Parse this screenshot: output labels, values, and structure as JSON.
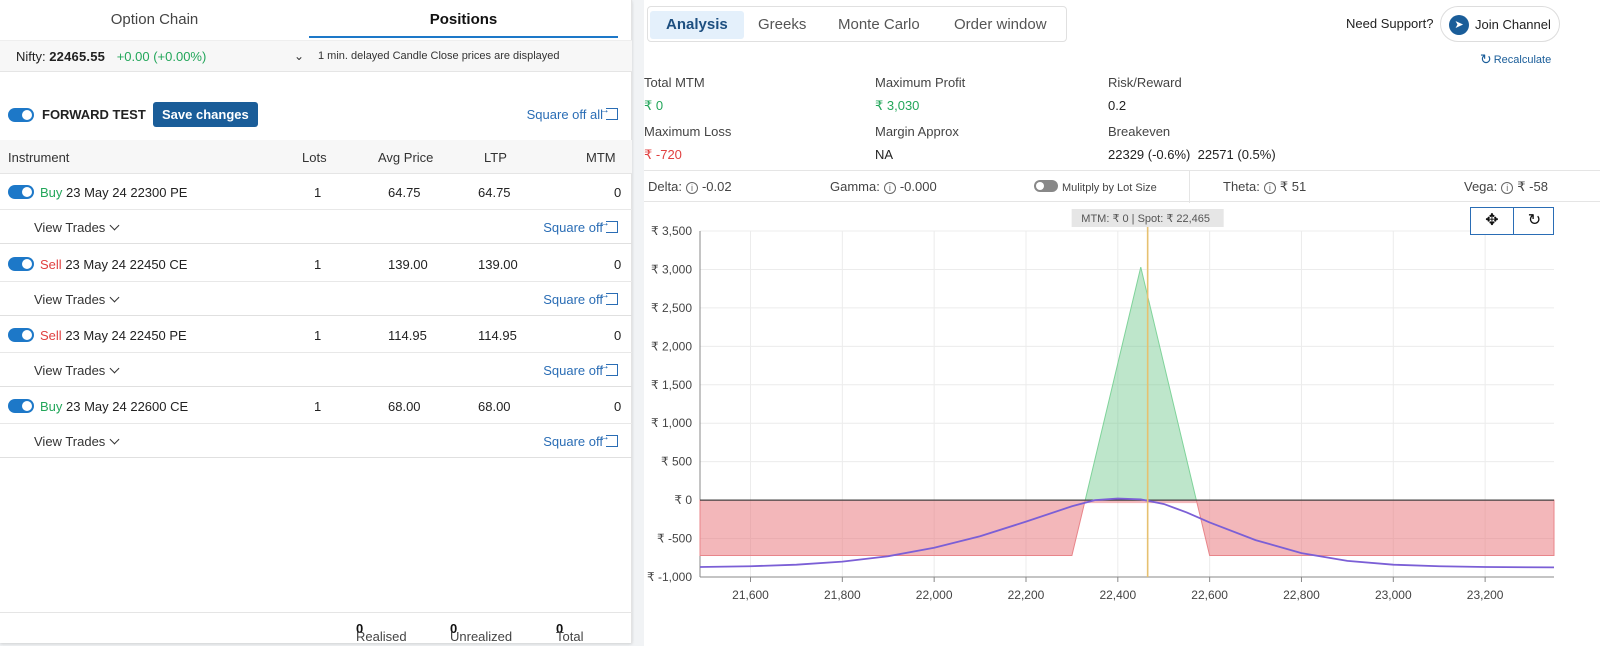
{
  "left": {
    "tabs": [
      {
        "label": "Option Chain"
      },
      {
        "label": "Positions"
      }
    ],
    "nifty": {
      "label": "Nifty:",
      "value": "22465.55",
      "change": "+0.00 (+0.00%)"
    },
    "delay_note": "1 min. delayed Candle Close prices are displayed",
    "forward_test": {
      "label": "FORWARD TEST",
      "save": "Save changes",
      "square_all": "Square off all"
    },
    "columns": {
      "instrument": "Instrument",
      "lots": "Lots",
      "avg": "Avg Price",
      "ltp": "LTP",
      "mtm": "MTM"
    },
    "positions": [
      {
        "side": "Buy",
        "name": "23 May 24 22300 PE",
        "lots": "1",
        "avg": "64.75",
        "ltp": "64.75",
        "mtm": "0",
        "view": "View Trades",
        "square": "Square off"
      },
      {
        "side": "Sell",
        "name": "23 May 24 22450 CE",
        "lots": "1",
        "avg": "139.00",
        "ltp": "139.00",
        "mtm": "0",
        "view": "View Trades",
        "square": "Square off"
      },
      {
        "side": "Sell",
        "name": "23 May 24 22450 PE",
        "lots": "1",
        "avg": "114.95",
        "ltp": "114.95",
        "mtm": "0",
        "view": "View Trades",
        "square": "Square off"
      },
      {
        "side": "Buy",
        "name": "23 May 24 22600 CE",
        "lots": "1",
        "avg": "68.00",
        "ltp": "68.00",
        "mtm": "0",
        "view": "View Trades",
        "square": "Square off"
      }
    ],
    "footer": {
      "realised_label": "Realised",
      "realised": "0",
      "unrealized_label": "Unrealized",
      "unrealized": "0",
      "total_label": "Total",
      "total": "0"
    }
  },
  "right": {
    "tabs": [
      {
        "label": "Analysis"
      },
      {
        "label": "Greeks"
      },
      {
        "label": "Monte Carlo"
      },
      {
        "label": "Order window"
      }
    ],
    "support": "Need Support?",
    "join": "Join Channel",
    "recalculate": "Recalculate",
    "stats": {
      "total_mtm": {
        "label": "Total MTM",
        "value": "₹ 0"
      },
      "max_profit": {
        "label": "Maximum Profit",
        "value": "₹ 3,030"
      },
      "risk_reward": {
        "label": "Risk/Reward",
        "value": "0.2"
      },
      "max_loss": {
        "label": "Maximum Loss",
        "value": "₹ -720"
      },
      "margin": {
        "label": "Margin Approx",
        "value": "NA"
      },
      "breakeven": {
        "label": "Breakeven",
        "value": "22329 (-0.6%)  22571 (0.5%)"
      }
    },
    "greeks": {
      "delta": {
        "label": "Delta:",
        "value": "-0.02"
      },
      "gamma": {
        "label": "Gamma:",
        "value": "-0.000"
      },
      "multiply": "Mulitply by Lot Size",
      "theta": {
        "label": "Theta:",
        "value": "₹ 51"
      },
      "vega": {
        "label": "Vega:",
        "value": "₹ -58"
      }
    },
    "icons": {
      "pan": "move-icon",
      "reset": "reset-icon",
      "telegram": "telegram-icon",
      "refresh": "refresh-icon"
    }
  },
  "chart_data": {
    "type": "area",
    "title": "",
    "annotation": "MTM: ₹ 0  |  Spot: ₹ 22,465",
    "spot": 22465,
    "xlim": [
      21490,
      23350
    ],
    "ylim": [
      -1000,
      3500
    ],
    "x_ticks": [
      21600,
      21800,
      22000,
      22200,
      22400,
      22600,
      22800,
      23000,
      23200
    ],
    "x_tick_labels": [
      "21,600",
      "21,800",
      "22,000",
      "22,200",
      "22,400",
      "22,600",
      "22,800",
      "23,000",
      "23,200"
    ],
    "y_ticks": [
      3500,
      3000,
      2500,
      2000,
      1500,
      1000,
      500,
      0,
      -500,
      -1000
    ],
    "y_tick_labels": [
      "₹ 3,500",
      "₹ 3,000",
      "₹ 2,500",
      "₹ 2,000",
      "₹ 1,500",
      "₹ 1,000",
      "₹ 500",
      "₹ 0",
      "₹ -500",
      "₹ -1,000"
    ],
    "grid": true,
    "series": [
      {
        "name": "",
        "kind": "expiry",
        "color": "#e8858a",
        "x": [
          21490,
          22300,
          22329,
          22450,
          22571,
          22600,
          23350
        ],
        "y": [
          -720,
          -720,
          0,
          3030,
          0,
          -720,
          -720
        ]
      },
      {
        "name": "",
        "kind": "target",
        "color": "#7b5fd6",
        "x": [
          21490,
          21600,
          21700,
          21800,
          21900,
          22000,
          22100,
          22200,
          22300,
          22350,
          22400,
          22450,
          22500,
          22550,
          22600,
          22700,
          22800,
          22900,
          23000,
          23100,
          23200,
          23350
        ],
        "y": [
          -870,
          -860,
          -840,
          -800,
          -730,
          -620,
          -470,
          -280,
          -80,
          0,
          20,
          10,
          -50,
          -160,
          -290,
          -520,
          -690,
          -790,
          -840,
          -860,
          -870,
          -875
        ]
      }
    ]
  }
}
